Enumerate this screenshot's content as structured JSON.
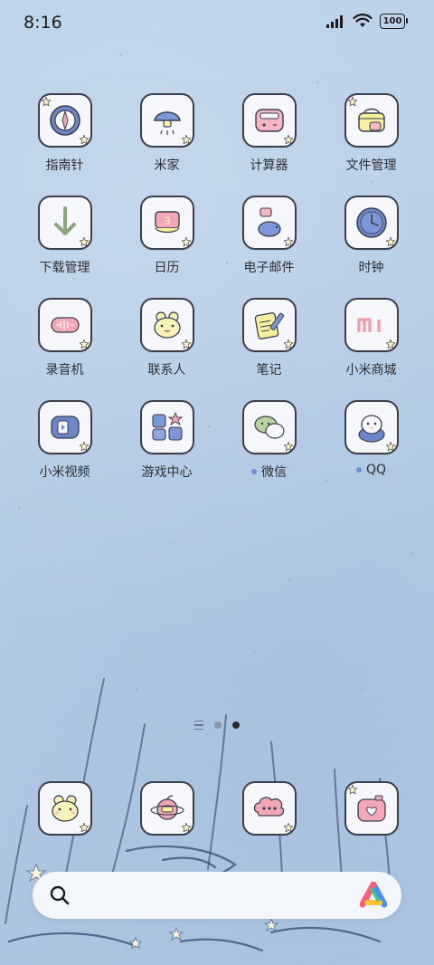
{
  "status_bar": {
    "time": "8:16",
    "battery": "100"
  },
  "apps": [
    {
      "label": "指南针",
      "icon": "compass-icon"
    },
    {
      "label": "米家",
      "icon": "mushroom-lamp-icon"
    },
    {
      "label": "计算器",
      "icon": "calculator-icon"
    },
    {
      "label": "文件管理",
      "icon": "folder-bag-icon"
    },
    {
      "label": "下载管理",
      "icon": "download-arrow-icon"
    },
    {
      "label": "日历",
      "icon": "calendar-cake-icon",
      "calendar_day": "3"
    },
    {
      "label": "电子邮件",
      "icon": "mail-piggy-icon"
    },
    {
      "label": "时钟",
      "icon": "clock-icon"
    },
    {
      "label": "录音机",
      "icon": "recorder-icon"
    },
    {
      "label": "联系人",
      "icon": "frog-contact-icon"
    },
    {
      "label": "笔记",
      "icon": "note-pencil-icon"
    },
    {
      "label": "小米商城",
      "icon": "mi-store-icon"
    },
    {
      "label": "小米视频",
      "icon": "video-player-icon"
    },
    {
      "label": "游戏中心",
      "icon": "game-puzzle-icon"
    },
    {
      "label": "微信",
      "icon": "wechat-icon",
      "has_notification_dot": true
    },
    {
      "label": "QQ",
      "icon": "qq-penguin-icon",
      "has_notification_dot": true
    }
  ],
  "dock": [
    {
      "icon": "frog-phone-icon"
    },
    {
      "icon": "apple-planet-icon"
    },
    {
      "icon": "cloud-message-icon"
    },
    {
      "icon": "heart-camera-icon"
    }
  ],
  "pager": {
    "pages": 2,
    "active_page": 2
  },
  "colors": {
    "wallpaper": "#b6cde6",
    "tile": "#f6f7fb",
    "accent_dot": "#6e8fd6"
  }
}
